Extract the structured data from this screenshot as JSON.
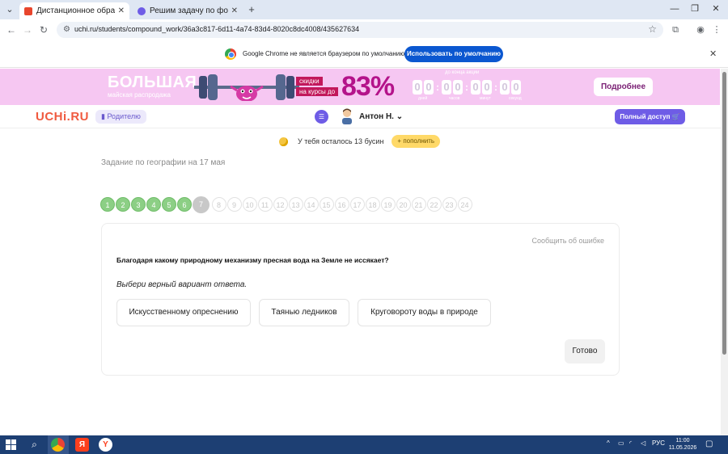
{
  "browser": {
    "tabs": [
      {
        "title": "Дистанционное образование",
        "active": true,
        "favicon_color": "#e8452c"
      },
      {
        "title": "Решим задачу по фото онлайн",
        "active": false,
        "favicon_color": "#6e5ce6"
      }
    ],
    "new_tab": "+",
    "url": "uchi.ru/students/compound_work/36a3c817-6d11-4a74-83d4-8020c8dc4008/435627634",
    "window_buttons": {
      "minimize": "—",
      "maximize": "❐",
      "close": "✕"
    }
  },
  "infobar": {
    "message": "Google Chrome не является браузером по умолчанию.",
    "button": "Использовать по умолчанию",
    "close": "✕"
  },
  "promo": {
    "headline": "БОЛЬШАЯ",
    "subline": "майская распродажа",
    "discount_line1": "скидки",
    "discount_line2": "на курсы до",
    "percent": "83%",
    "timer_caption": "до конца акции",
    "timer_digits": [
      "0",
      "0",
      "0",
      "0",
      "0",
      "0",
      "0",
      "0"
    ],
    "timer_labels": [
      "дней",
      "часов",
      "минут",
      "секунд"
    ],
    "button": "Подробнее",
    "accent": "#b4138a"
  },
  "header": {
    "logo": "UCHi.RU",
    "parents_label": "Родителю",
    "user_name": "Антон Н. ⌄",
    "full_access": "Полный доступ 🛒",
    "accent": "#6e5ce6"
  },
  "coins": {
    "text": "У тебя осталось 13 бусин",
    "topup": "+ пополнить"
  },
  "task": {
    "title": "Задание по географии на 17 мая",
    "steps": [
      {
        "n": "1",
        "state": "done"
      },
      {
        "n": "2",
        "state": "done"
      },
      {
        "n": "3",
        "state": "done"
      },
      {
        "n": "4",
        "state": "done"
      },
      {
        "n": "5",
        "state": "done"
      },
      {
        "n": "6",
        "state": "done"
      },
      {
        "n": "7",
        "state": "current"
      },
      {
        "n": "8",
        "state": "todo"
      },
      {
        "n": "9",
        "state": "todo"
      },
      {
        "n": "10",
        "state": "todo"
      },
      {
        "n": "11",
        "state": "todo"
      },
      {
        "n": "12",
        "state": "todo"
      },
      {
        "n": "13",
        "state": "todo"
      },
      {
        "n": "14",
        "state": "todo"
      },
      {
        "n": "15",
        "state": "todo"
      },
      {
        "n": "16",
        "state": "todo"
      },
      {
        "n": "17",
        "state": "todo"
      },
      {
        "n": "18",
        "state": "todo"
      },
      {
        "n": "19",
        "state": "todo"
      },
      {
        "n": "20",
        "state": "todo"
      },
      {
        "n": "21",
        "state": "todo"
      },
      {
        "n": "22",
        "state": "todo"
      },
      {
        "n": "23",
        "state": "todo"
      },
      {
        "n": "24",
        "state": "todo"
      }
    ],
    "report_error": "Сообщить об ошибке",
    "question": "Благодаря какому природному механизму пресная вода на Земле не иссякает?",
    "instruction": "Выбери верный вариант ответа.",
    "options": [
      "Искусственному опреснению",
      "Таянью ледников",
      "Круговороту воды в природе"
    ],
    "done_button": "Готово",
    "done_color": "#8ccf85"
  },
  "taskbar": {
    "language": "РУС",
    "time": "11:00",
    "date": "11.05.2026"
  }
}
